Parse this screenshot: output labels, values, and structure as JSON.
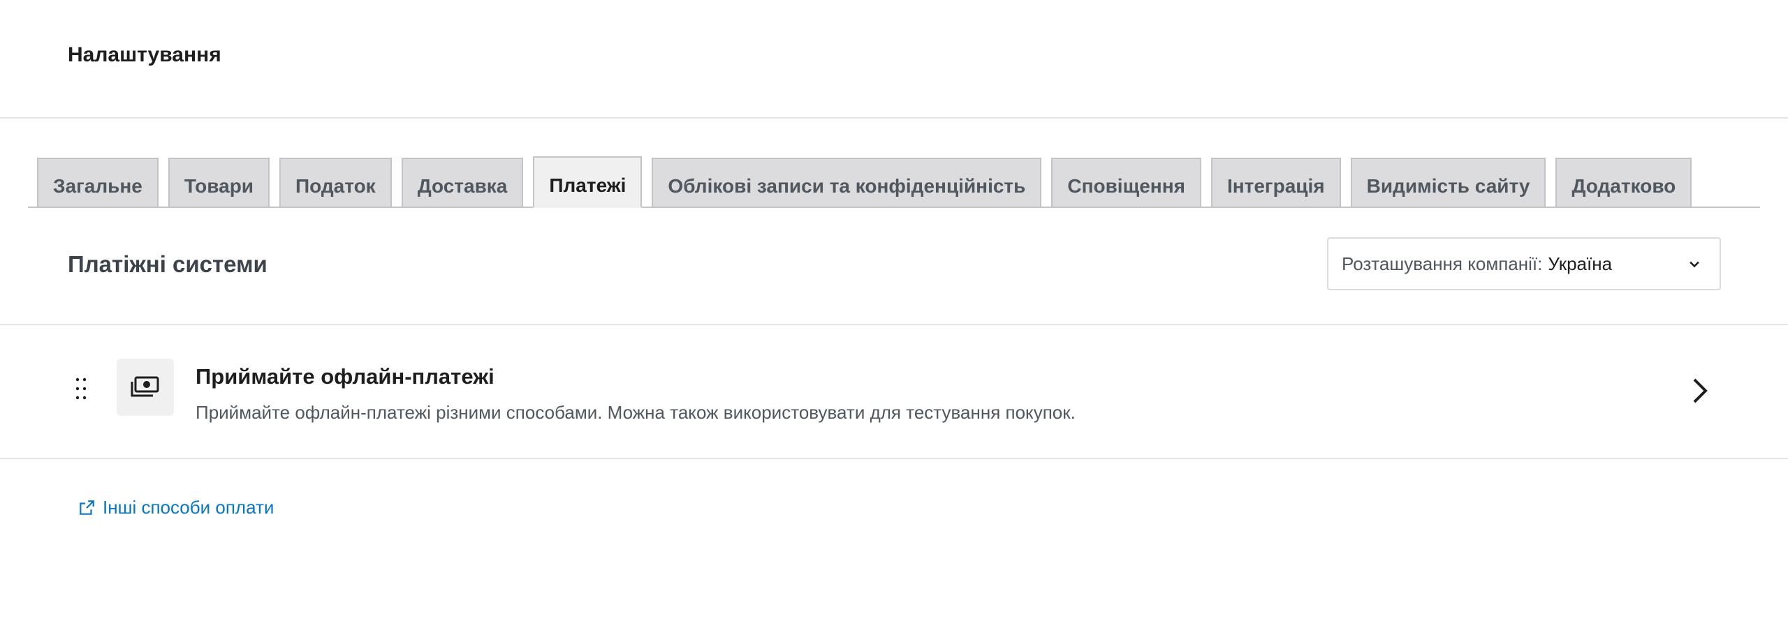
{
  "header": {
    "title": "Налаштування"
  },
  "tabs": [
    {
      "label": "Загальне",
      "active": false
    },
    {
      "label": "Товари",
      "active": false
    },
    {
      "label": "Податок",
      "active": false
    },
    {
      "label": "Доставка",
      "active": false
    },
    {
      "label": "Платежі",
      "active": true
    },
    {
      "label": "Облікові записи та конфіденційність",
      "active": false
    },
    {
      "label": "Сповіщення",
      "active": false
    },
    {
      "label": "Інтеграція",
      "active": false
    },
    {
      "label": "Видимість сайту",
      "active": false
    },
    {
      "label": "Додатково",
      "active": false
    }
  ],
  "section": {
    "title": "Платіжні системи",
    "location_label": "Розташування компанії:",
    "location_value": "Україна"
  },
  "payment": {
    "title": "Приймайте офлайн-платежі",
    "description": "Приймайте офлайн-платежі різними способами. Можна також використовувати для тестування покупок.",
    "icon": "money-icon"
  },
  "other_link": {
    "label": "Інші способи оплати",
    "icon": "external-link-icon"
  },
  "colors": {
    "link": "#0675c4",
    "tab_active_bg": "#f0f0f1",
    "tab_bg": "#dcdcde"
  }
}
